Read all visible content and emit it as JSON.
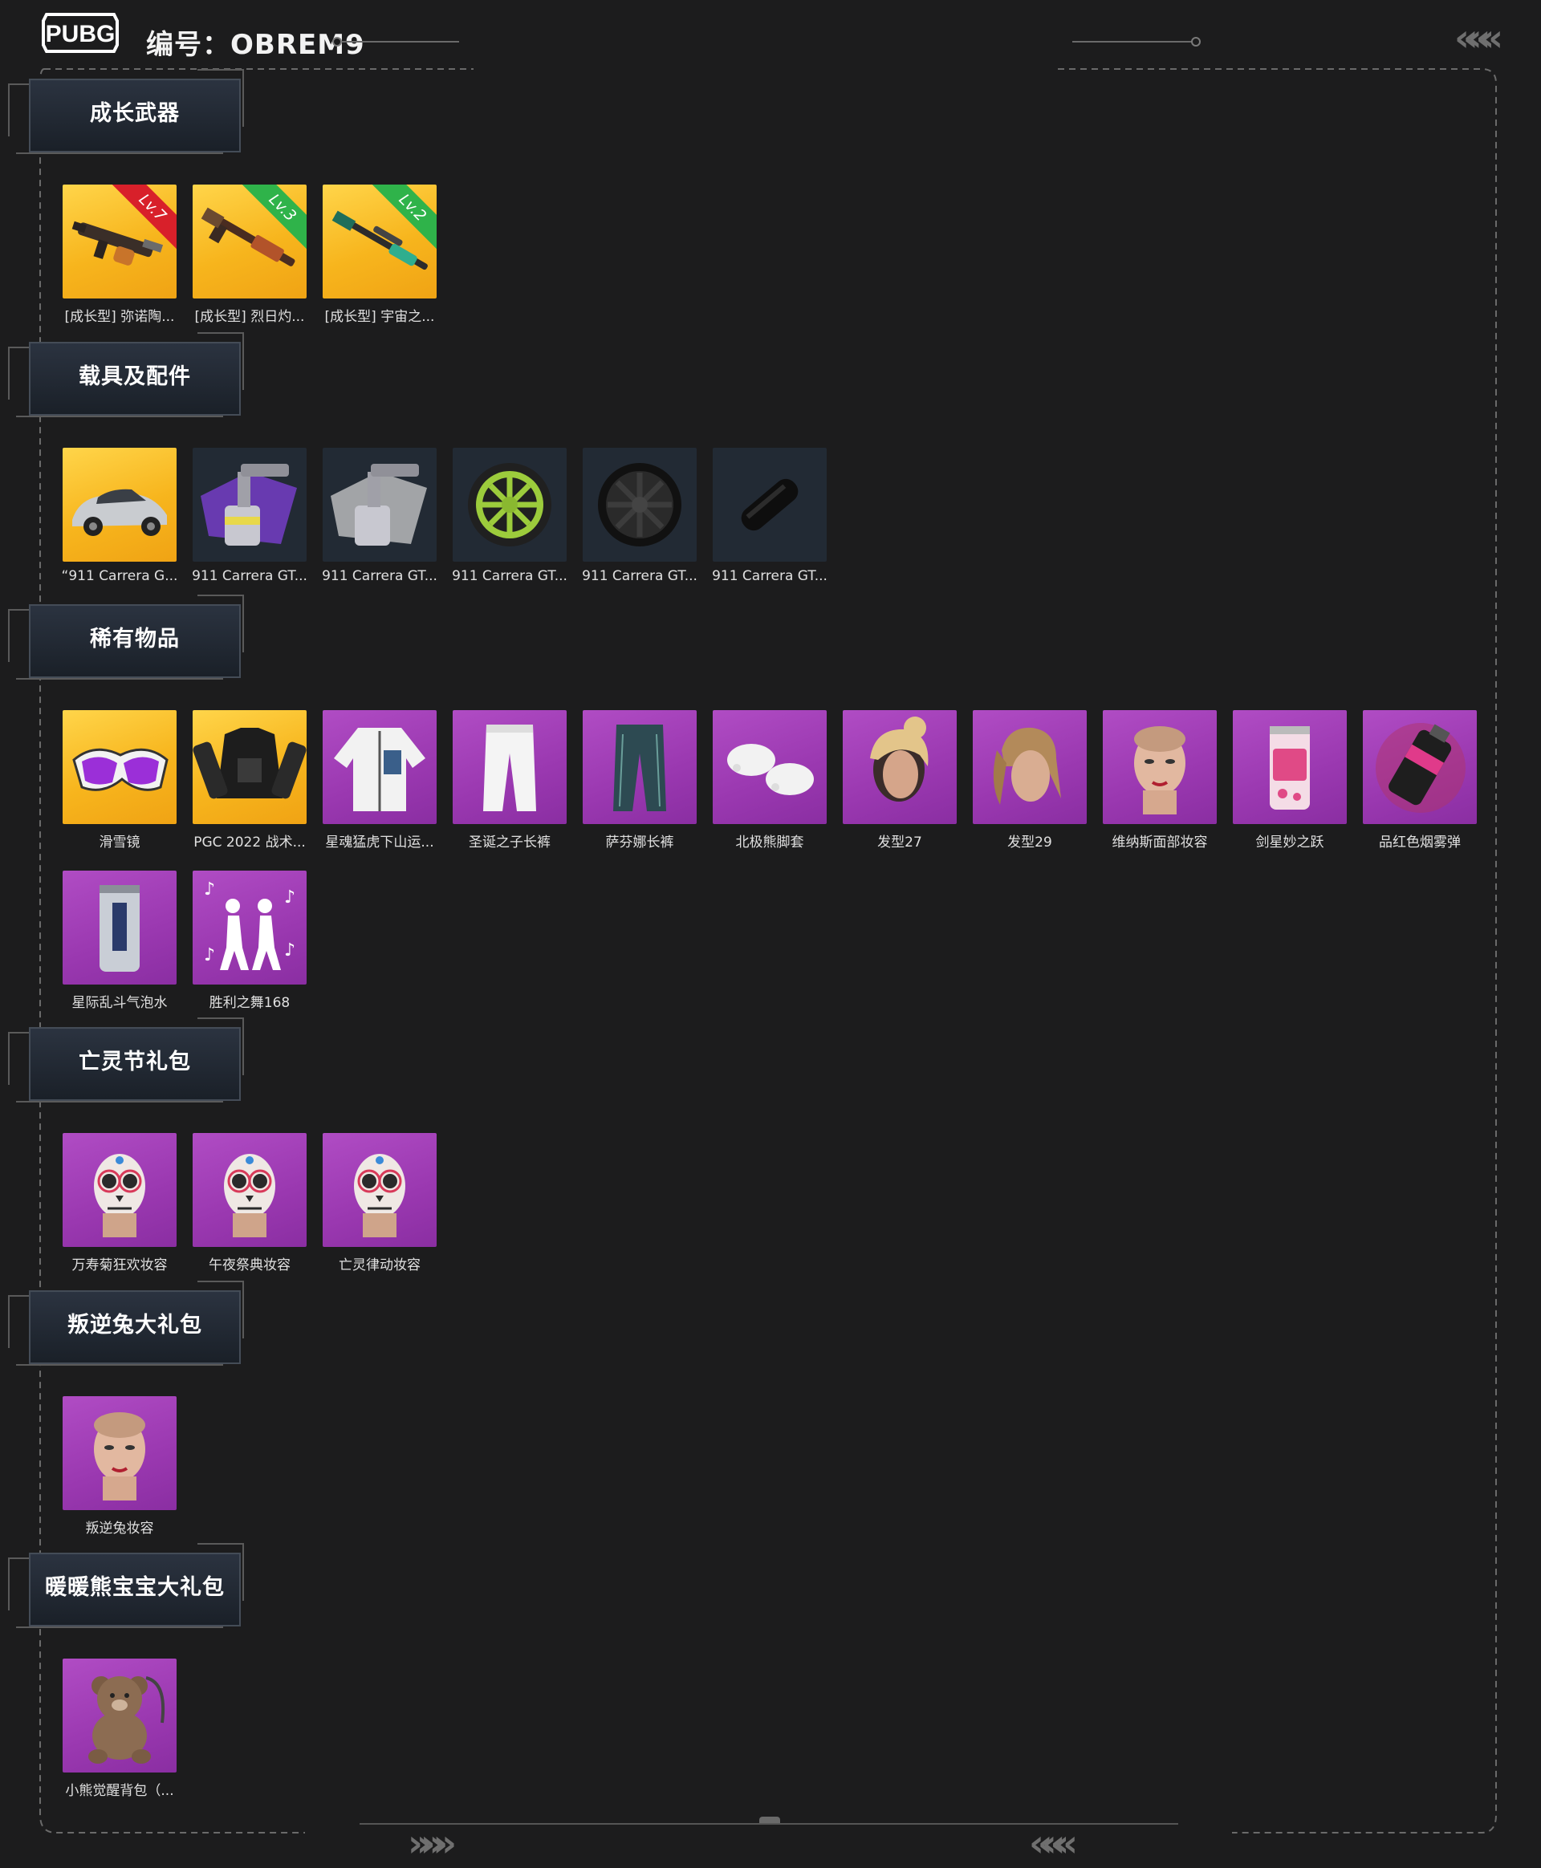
{
  "header": {
    "logo_text": "PUBG",
    "id_label": "编号：OBREM9",
    "left_chevrons": "«««",
    "right_chevrons": "«««"
  },
  "footer": {
    "right_arrows_left": "»»»",
    "right_arrows_mid": "«««"
  },
  "sections": [
    {
      "title": "成长武器",
      "items": [
        {
          "name": "[成长型] 弥诺陶...",
          "bg": "gold",
          "icon": "smg-icon",
          "badge": "Lv.7",
          "badge_color": "red"
        },
        {
          "name": "[成长型] 烈日灼...",
          "bg": "gold",
          "icon": "rifle-icon",
          "badge": "Lv.3",
          "badge_color": "green"
        },
        {
          "name": "[成长型] 宇宙之...",
          "bg": "gold",
          "icon": "sniper-icon",
          "badge": "Lv.2",
          "badge_color": "green"
        }
      ]
    },
    {
      "title": "载具及配件",
      "items": [
        {
          "name": "“911 Carrera G...",
          "bg": "gold",
          "icon": "car-icon"
        },
        {
          "name": "911 Carrera GT...",
          "bg": "dark",
          "icon": "spray-gun-purple-icon"
        },
        {
          "name": "911 Carrera GT...",
          "bg": "dark",
          "icon": "spray-gun-white-icon"
        },
        {
          "name": "911 Carrera GT...",
          "bg": "dark",
          "icon": "wheel-green-icon"
        },
        {
          "name": "911 Carrera GT...",
          "bg": "dark",
          "icon": "wheel-black-icon"
        },
        {
          "name": "911 Carrera GT...",
          "bg": "dark",
          "icon": "brake-caliper-icon"
        }
      ]
    },
    {
      "title": "稀有物品",
      "items": [
        {
          "name": "滑雪镜",
          "bg": "gold",
          "icon": "goggles-icon"
        },
        {
          "name": "PGC 2022 战术...",
          "bg": "gold",
          "icon": "tactical-vest-icon"
        },
        {
          "name": "星魂猛虎下山运...",
          "bg": "purple",
          "icon": "jacket-icon"
        },
        {
          "name": "圣诞之子长裤",
          "bg": "purple",
          "icon": "white-pants-icon"
        },
        {
          "name": "萨芬娜长裤",
          "bg": "purple",
          "icon": "teal-pants-icon"
        },
        {
          "name": "北极熊脚套",
          "bg": "purple",
          "icon": "paw-shoes-icon"
        },
        {
          "name": "发型27",
          "bg": "purple",
          "icon": "hair-bun-icon"
        },
        {
          "name": "发型29",
          "bg": "purple",
          "icon": "hair-ponytail-icon"
        },
        {
          "name": "维纳斯面部妆容",
          "bg": "purple",
          "icon": "face-makeup-icon"
        },
        {
          "name": "剑星妙之跃",
          "bg": "purple",
          "icon": "soda-can-pink-icon"
        },
        {
          "name": "品红色烟雾弹",
          "bg": "purple",
          "icon": "smoke-grenade-icon"
        },
        {
          "name": "星际乱斗气泡水",
          "bg": "purple",
          "icon": "soda-can-silver-icon"
        },
        {
          "name": "胜利之舞168",
          "bg": "purple",
          "icon": "dance-emote-icon"
        }
      ]
    },
    {
      "title": "亡灵节礼包",
      "items": [
        {
          "name": "万寿菊狂欢妆容",
          "bg": "purple",
          "icon": "skull-face-icon"
        },
        {
          "name": "午夜祭典妆容",
          "bg": "purple",
          "icon": "skull-face-icon"
        },
        {
          "name": "亡灵律动妆容",
          "bg": "purple",
          "icon": "skull-face-icon"
        }
      ]
    },
    {
      "title": "叛逆兔大礼包",
      "items": [
        {
          "name": "叛逆兔妆容",
          "bg": "purple",
          "icon": "face-makeup-icon"
        }
      ]
    },
    {
      "title": "暖暖熊宝宝大礼包",
      "items": [
        {
          "name": "小熊觉醒背包（...",
          "bg": "purple",
          "icon": "teddy-bear-backpack-icon"
        }
      ]
    }
  ]
}
